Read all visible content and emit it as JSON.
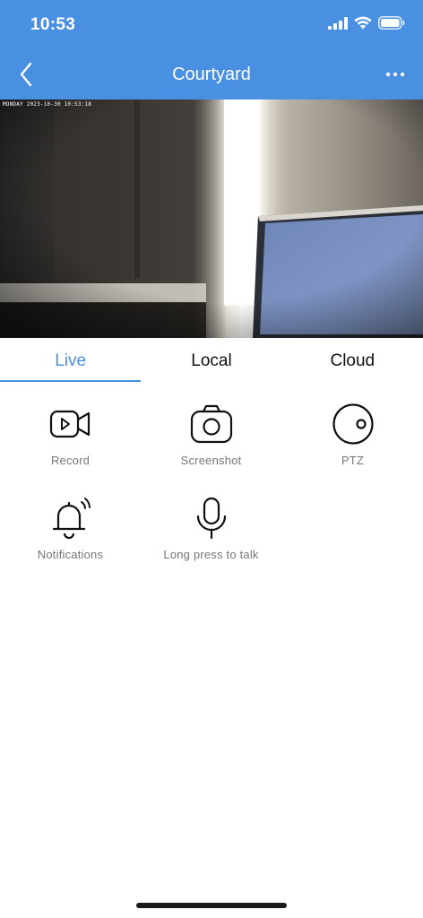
{
  "status_bar": {
    "time": "10:53"
  },
  "nav": {
    "title": "Courtyard",
    "back_icon": "chevron-left-icon",
    "more_icon": "more-icon"
  },
  "video": {
    "osd_timestamp": "MONDAY 2023-10-30 10:53:18"
  },
  "tabs": [
    {
      "label": "Live",
      "active": true
    },
    {
      "label": "Local",
      "active": false
    },
    {
      "label": "Cloud",
      "active": false
    }
  ],
  "actions": [
    {
      "label": "Record",
      "icon": "video-camera-icon"
    },
    {
      "label": "Screenshot",
      "icon": "camera-icon"
    },
    {
      "label": "PTZ",
      "icon": "ptz-icon"
    },
    {
      "label": "Notifications",
      "icon": "bell-icon"
    },
    {
      "label": "Long press to talk",
      "icon": "microphone-icon"
    }
  ],
  "colors": {
    "accent": "#4a90e2",
    "label_gray": "#777777"
  }
}
